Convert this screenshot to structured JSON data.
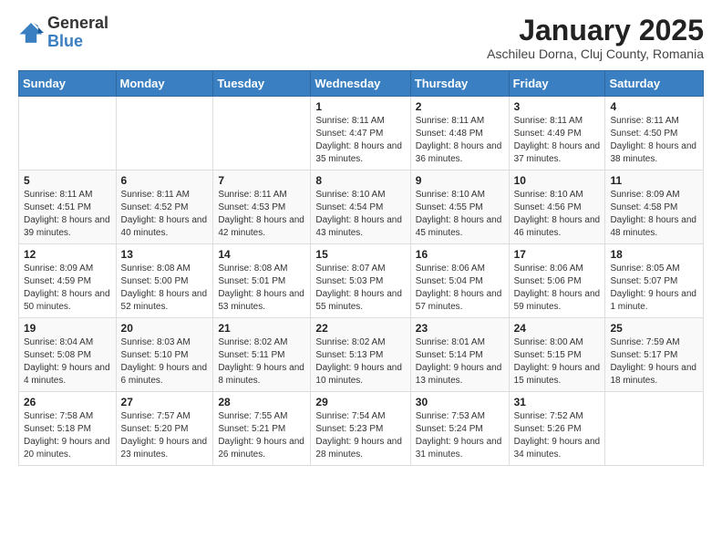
{
  "header": {
    "logo_general": "General",
    "logo_blue": "Blue",
    "month_title": "January 2025",
    "subtitle": "Aschileu Dorna, Cluj County, Romania"
  },
  "weekdays": [
    "Sunday",
    "Monday",
    "Tuesday",
    "Wednesday",
    "Thursday",
    "Friday",
    "Saturday"
  ],
  "weeks": [
    [
      {
        "day": "",
        "info": ""
      },
      {
        "day": "",
        "info": ""
      },
      {
        "day": "",
        "info": ""
      },
      {
        "day": "1",
        "info": "Sunrise: 8:11 AM\nSunset: 4:47 PM\nDaylight: 8 hours and 35 minutes."
      },
      {
        "day": "2",
        "info": "Sunrise: 8:11 AM\nSunset: 4:48 PM\nDaylight: 8 hours and 36 minutes."
      },
      {
        "day": "3",
        "info": "Sunrise: 8:11 AM\nSunset: 4:49 PM\nDaylight: 8 hours and 37 minutes."
      },
      {
        "day": "4",
        "info": "Sunrise: 8:11 AM\nSunset: 4:50 PM\nDaylight: 8 hours and 38 minutes."
      }
    ],
    [
      {
        "day": "5",
        "info": "Sunrise: 8:11 AM\nSunset: 4:51 PM\nDaylight: 8 hours and 39 minutes."
      },
      {
        "day": "6",
        "info": "Sunrise: 8:11 AM\nSunset: 4:52 PM\nDaylight: 8 hours and 40 minutes."
      },
      {
        "day": "7",
        "info": "Sunrise: 8:11 AM\nSunset: 4:53 PM\nDaylight: 8 hours and 42 minutes."
      },
      {
        "day": "8",
        "info": "Sunrise: 8:10 AM\nSunset: 4:54 PM\nDaylight: 8 hours and 43 minutes."
      },
      {
        "day": "9",
        "info": "Sunrise: 8:10 AM\nSunset: 4:55 PM\nDaylight: 8 hours and 45 minutes."
      },
      {
        "day": "10",
        "info": "Sunrise: 8:10 AM\nSunset: 4:56 PM\nDaylight: 8 hours and 46 minutes."
      },
      {
        "day": "11",
        "info": "Sunrise: 8:09 AM\nSunset: 4:58 PM\nDaylight: 8 hours and 48 minutes."
      }
    ],
    [
      {
        "day": "12",
        "info": "Sunrise: 8:09 AM\nSunset: 4:59 PM\nDaylight: 8 hours and 50 minutes."
      },
      {
        "day": "13",
        "info": "Sunrise: 8:08 AM\nSunset: 5:00 PM\nDaylight: 8 hours and 52 minutes."
      },
      {
        "day": "14",
        "info": "Sunrise: 8:08 AM\nSunset: 5:01 PM\nDaylight: 8 hours and 53 minutes."
      },
      {
        "day": "15",
        "info": "Sunrise: 8:07 AM\nSunset: 5:03 PM\nDaylight: 8 hours and 55 minutes."
      },
      {
        "day": "16",
        "info": "Sunrise: 8:06 AM\nSunset: 5:04 PM\nDaylight: 8 hours and 57 minutes."
      },
      {
        "day": "17",
        "info": "Sunrise: 8:06 AM\nSunset: 5:06 PM\nDaylight: 8 hours and 59 minutes."
      },
      {
        "day": "18",
        "info": "Sunrise: 8:05 AM\nSunset: 5:07 PM\nDaylight: 9 hours and 1 minute."
      }
    ],
    [
      {
        "day": "19",
        "info": "Sunrise: 8:04 AM\nSunset: 5:08 PM\nDaylight: 9 hours and 4 minutes."
      },
      {
        "day": "20",
        "info": "Sunrise: 8:03 AM\nSunset: 5:10 PM\nDaylight: 9 hours and 6 minutes."
      },
      {
        "day": "21",
        "info": "Sunrise: 8:02 AM\nSunset: 5:11 PM\nDaylight: 9 hours and 8 minutes."
      },
      {
        "day": "22",
        "info": "Sunrise: 8:02 AM\nSunset: 5:13 PM\nDaylight: 9 hours and 10 minutes."
      },
      {
        "day": "23",
        "info": "Sunrise: 8:01 AM\nSunset: 5:14 PM\nDaylight: 9 hours and 13 minutes."
      },
      {
        "day": "24",
        "info": "Sunrise: 8:00 AM\nSunset: 5:15 PM\nDaylight: 9 hours and 15 minutes."
      },
      {
        "day": "25",
        "info": "Sunrise: 7:59 AM\nSunset: 5:17 PM\nDaylight: 9 hours and 18 minutes."
      }
    ],
    [
      {
        "day": "26",
        "info": "Sunrise: 7:58 AM\nSunset: 5:18 PM\nDaylight: 9 hours and 20 minutes."
      },
      {
        "day": "27",
        "info": "Sunrise: 7:57 AM\nSunset: 5:20 PM\nDaylight: 9 hours and 23 minutes."
      },
      {
        "day": "28",
        "info": "Sunrise: 7:55 AM\nSunset: 5:21 PM\nDaylight: 9 hours and 26 minutes."
      },
      {
        "day": "29",
        "info": "Sunrise: 7:54 AM\nSunset: 5:23 PM\nDaylight: 9 hours and 28 minutes."
      },
      {
        "day": "30",
        "info": "Sunrise: 7:53 AM\nSunset: 5:24 PM\nDaylight: 9 hours and 31 minutes."
      },
      {
        "day": "31",
        "info": "Sunrise: 7:52 AM\nSunset: 5:26 PM\nDaylight: 9 hours and 34 minutes."
      },
      {
        "day": "",
        "info": ""
      }
    ]
  ]
}
